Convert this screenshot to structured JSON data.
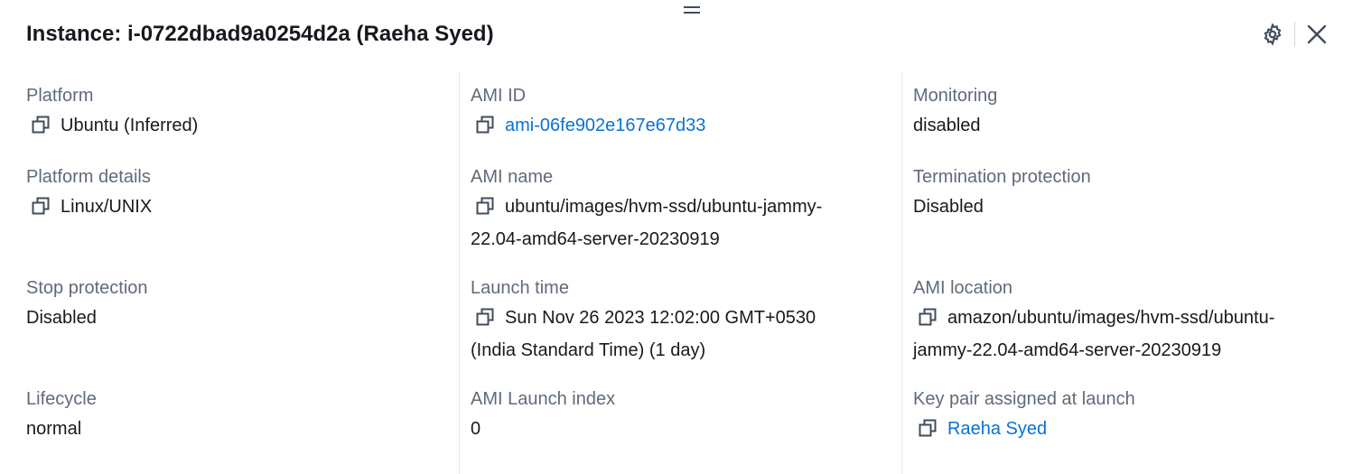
{
  "panel": {
    "title": "Instance: i-0722dbad9a0254d2a (Raeha Syed)"
  },
  "icons": {
    "drag": "drag-handle-icon",
    "settings": "gear-icon",
    "close": "close-icon",
    "copy": "copy-icon"
  },
  "colors": {
    "link": "#0972d3",
    "label": "#5f6b7a",
    "text": "#16191f"
  },
  "col1": {
    "platform": {
      "label": "Platform",
      "value": "Ubuntu (Inferred)"
    },
    "platform_details": {
      "label": "Platform details",
      "value": "Linux/UNIX"
    },
    "stop_protection": {
      "label": "Stop protection",
      "value": "Disabled"
    },
    "lifecycle": {
      "label": "Lifecycle",
      "value": "normal"
    }
  },
  "col2": {
    "ami_id": {
      "label": "AMI ID",
      "value": "ami-06fe902e167e67d33"
    },
    "ami_name": {
      "label": "AMI name",
      "value_line1": "ubuntu/images/hvm-ssd/ubuntu-jammy-",
      "value_line2": "22.04-amd64-server-20230919"
    },
    "launch_time": {
      "label": "Launch time",
      "value_line1": "Sun Nov 26 2023 12:02:00 GMT+0530",
      "value_line2": "(India Standard Time) (1 day)"
    },
    "ami_launch_index": {
      "label": "AMI Launch index",
      "value": "0"
    }
  },
  "col3": {
    "monitoring": {
      "label": "Monitoring",
      "value": "disabled"
    },
    "termination_protection": {
      "label": "Termination protection",
      "value": "Disabled"
    },
    "ami_location": {
      "label": "AMI location",
      "value_line1": "amazon/ubuntu/images/hvm-ssd/ubuntu-",
      "value_line2": "jammy-22.04-amd64-server-20230919"
    },
    "key_pair": {
      "label": "Key pair assigned at launch",
      "value": "Raeha Syed"
    }
  }
}
